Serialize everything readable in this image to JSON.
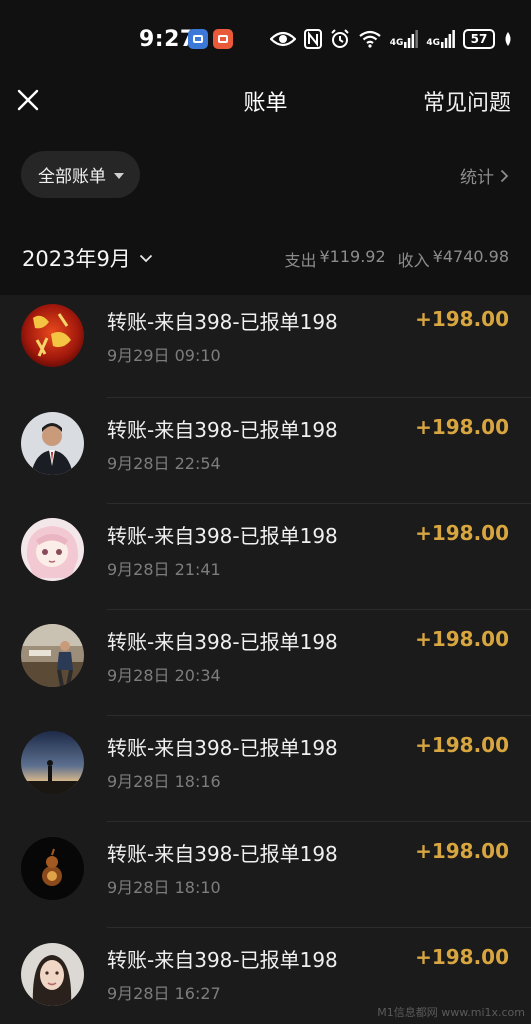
{
  "status_bar": {
    "time": "9:27",
    "battery": "57",
    "network_1": "4G",
    "network_2": "4G"
  },
  "header": {
    "title": "账单",
    "faq_label": "常见问题"
  },
  "filter": {
    "all_bills_label": "全部账单",
    "stats_label": "统计"
  },
  "month": {
    "label": "2023年9月",
    "expense_label": "支出",
    "expense_value": "¥119.92",
    "income_label": "收入",
    "income_value": "¥4740.98"
  },
  "transactions": [
    {
      "title": "转账-来自398-已报单198",
      "time": "9月29日 09:10",
      "amount": "+198.00",
      "avatar": "red-calligraphy-avatar"
    },
    {
      "title": "转账-来自398-已报单198",
      "time": "9月28日 22:54",
      "amount": "+198.00",
      "avatar": "man-in-suit-avatar"
    },
    {
      "title": "转账-来自398-已报单198",
      "time": "9月28日 21:41",
      "amount": "+198.00",
      "avatar": "anime-girl-avatar"
    },
    {
      "title": "转账-来自398-已报单198",
      "time": "9月28日 20:34",
      "amount": "+198.00",
      "avatar": "man-outdoors-avatar"
    },
    {
      "title": "转账-来自398-已报单198",
      "time": "9月28日 18:16",
      "amount": "+198.00",
      "avatar": "sunset-silhouette-avatar"
    },
    {
      "title": "转账-来自398-已报单198",
      "time": "9月28日 18:10",
      "amount": "+198.00",
      "avatar": "dark-gourd-avatar"
    },
    {
      "title": "转账-来自398-已报单198",
      "time": "9月28日 16:27",
      "amount": "+198.00",
      "avatar": "woman-portrait-avatar"
    }
  ],
  "watermark": "M1信息都网 www.mi1x.com",
  "colors": {
    "background": "#111111",
    "list_background": "#1b1b1b",
    "amount": "#d8a640",
    "secondary_text": "#8c8c8c"
  }
}
